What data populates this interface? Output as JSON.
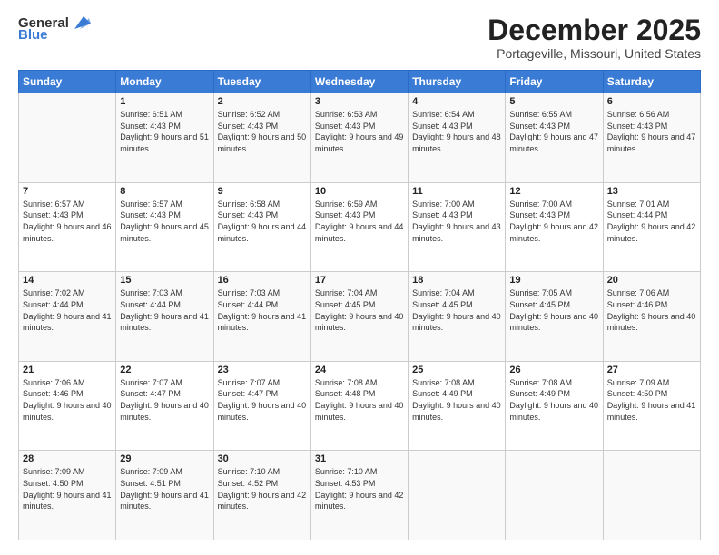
{
  "logo": {
    "general": "General",
    "blue": "Blue"
  },
  "title": "December 2025",
  "location": "Portageville, Missouri, United States",
  "days_header": [
    "Sunday",
    "Monday",
    "Tuesday",
    "Wednesday",
    "Thursday",
    "Friday",
    "Saturday"
  ],
  "weeks": [
    [
      {
        "day": "",
        "sunrise": "",
        "sunset": "",
        "daylight": ""
      },
      {
        "day": "1",
        "sunrise": "Sunrise: 6:51 AM",
        "sunset": "Sunset: 4:43 PM",
        "daylight": "Daylight: 9 hours and 51 minutes."
      },
      {
        "day": "2",
        "sunrise": "Sunrise: 6:52 AM",
        "sunset": "Sunset: 4:43 PM",
        "daylight": "Daylight: 9 hours and 50 minutes."
      },
      {
        "day": "3",
        "sunrise": "Sunrise: 6:53 AM",
        "sunset": "Sunset: 4:43 PM",
        "daylight": "Daylight: 9 hours and 49 minutes."
      },
      {
        "day": "4",
        "sunrise": "Sunrise: 6:54 AM",
        "sunset": "Sunset: 4:43 PM",
        "daylight": "Daylight: 9 hours and 48 minutes."
      },
      {
        "day": "5",
        "sunrise": "Sunrise: 6:55 AM",
        "sunset": "Sunset: 4:43 PM",
        "daylight": "Daylight: 9 hours and 47 minutes."
      },
      {
        "day": "6",
        "sunrise": "Sunrise: 6:56 AM",
        "sunset": "Sunset: 4:43 PM",
        "daylight": "Daylight: 9 hours and 47 minutes."
      }
    ],
    [
      {
        "day": "7",
        "sunrise": "Sunrise: 6:57 AM",
        "sunset": "Sunset: 4:43 PM",
        "daylight": "Daylight: 9 hours and 46 minutes."
      },
      {
        "day": "8",
        "sunrise": "Sunrise: 6:57 AM",
        "sunset": "Sunset: 4:43 PM",
        "daylight": "Daylight: 9 hours and 45 minutes."
      },
      {
        "day": "9",
        "sunrise": "Sunrise: 6:58 AM",
        "sunset": "Sunset: 4:43 PM",
        "daylight": "Daylight: 9 hours and 44 minutes."
      },
      {
        "day": "10",
        "sunrise": "Sunrise: 6:59 AM",
        "sunset": "Sunset: 4:43 PM",
        "daylight": "Daylight: 9 hours and 44 minutes."
      },
      {
        "day": "11",
        "sunrise": "Sunrise: 7:00 AM",
        "sunset": "Sunset: 4:43 PM",
        "daylight": "Daylight: 9 hours and 43 minutes."
      },
      {
        "day": "12",
        "sunrise": "Sunrise: 7:00 AM",
        "sunset": "Sunset: 4:43 PM",
        "daylight": "Daylight: 9 hours and 42 minutes."
      },
      {
        "day": "13",
        "sunrise": "Sunrise: 7:01 AM",
        "sunset": "Sunset: 4:44 PM",
        "daylight": "Daylight: 9 hours and 42 minutes."
      }
    ],
    [
      {
        "day": "14",
        "sunrise": "Sunrise: 7:02 AM",
        "sunset": "Sunset: 4:44 PM",
        "daylight": "Daylight: 9 hours and 41 minutes."
      },
      {
        "day": "15",
        "sunrise": "Sunrise: 7:03 AM",
        "sunset": "Sunset: 4:44 PM",
        "daylight": "Daylight: 9 hours and 41 minutes."
      },
      {
        "day": "16",
        "sunrise": "Sunrise: 7:03 AM",
        "sunset": "Sunset: 4:44 PM",
        "daylight": "Daylight: 9 hours and 41 minutes."
      },
      {
        "day": "17",
        "sunrise": "Sunrise: 7:04 AM",
        "sunset": "Sunset: 4:45 PM",
        "daylight": "Daylight: 9 hours and 40 minutes."
      },
      {
        "day": "18",
        "sunrise": "Sunrise: 7:04 AM",
        "sunset": "Sunset: 4:45 PM",
        "daylight": "Daylight: 9 hours and 40 minutes."
      },
      {
        "day": "19",
        "sunrise": "Sunrise: 7:05 AM",
        "sunset": "Sunset: 4:45 PM",
        "daylight": "Daylight: 9 hours and 40 minutes."
      },
      {
        "day": "20",
        "sunrise": "Sunrise: 7:06 AM",
        "sunset": "Sunset: 4:46 PM",
        "daylight": "Daylight: 9 hours and 40 minutes."
      }
    ],
    [
      {
        "day": "21",
        "sunrise": "Sunrise: 7:06 AM",
        "sunset": "Sunset: 4:46 PM",
        "daylight": "Daylight: 9 hours and 40 minutes."
      },
      {
        "day": "22",
        "sunrise": "Sunrise: 7:07 AM",
        "sunset": "Sunset: 4:47 PM",
        "daylight": "Daylight: 9 hours and 40 minutes."
      },
      {
        "day": "23",
        "sunrise": "Sunrise: 7:07 AM",
        "sunset": "Sunset: 4:47 PM",
        "daylight": "Daylight: 9 hours and 40 minutes."
      },
      {
        "day": "24",
        "sunrise": "Sunrise: 7:08 AM",
        "sunset": "Sunset: 4:48 PM",
        "daylight": "Daylight: 9 hours and 40 minutes."
      },
      {
        "day": "25",
        "sunrise": "Sunrise: 7:08 AM",
        "sunset": "Sunset: 4:49 PM",
        "daylight": "Daylight: 9 hours and 40 minutes."
      },
      {
        "day": "26",
        "sunrise": "Sunrise: 7:08 AM",
        "sunset": "Sunset: 4:49 PM",
        "daylight": "Daylight: 9 hours and 40 minutes."
      },
      {
        "day": "27",
        "sunrise": "Sunrise: 7:09 AM",
        "sunset": "Sunset: 4:50 PM",
        "daylight": "Daylight: 9 hours and 41 minutes."
      }
    ],
    [
      {
        "day": "28",
        "sunrise": "Sunrise: 7:09 AM",
        "sunset": "Sunset: 4:50 PM",
        "daylight": "Daylight: 9 hours and 41 minutes."
      },
      {
        "day": "29",
        "sunrise": "Sunrise: 7:09 AM",
        "sunset": "Sunset: 4:51 PM",
        "daylight": "Daylight: 9 hours and 41 minutes."
      },
      {
        "day": "30",
        "sunrise": "Sunrise: 7:10 AM",
        "sunset": "Sunset: 4:52 PM",
        "daylight": "Daylight: 9 hours and 42 minutes."
      },
      {
        "day": "31",
        "sunrise": "Sunrise: 7:10 AM",
        "sunset": "Sunset: 4:53 PM",
        "daylight": "Daylight: 9 hours and 42 minutes."
      },
      {
        "day": "",
        "sunrise": "",
        "sunset": "",
        "daylight": ""
      },
      {
        "day": "",
        "sunrise": "",
        "sunset": "",
        "daylight": ""
      },
      {
        "day": "",
        "sunrise": "",
        "sunset": "",
        "daylight": ""
      }
    ]
  ]
}
